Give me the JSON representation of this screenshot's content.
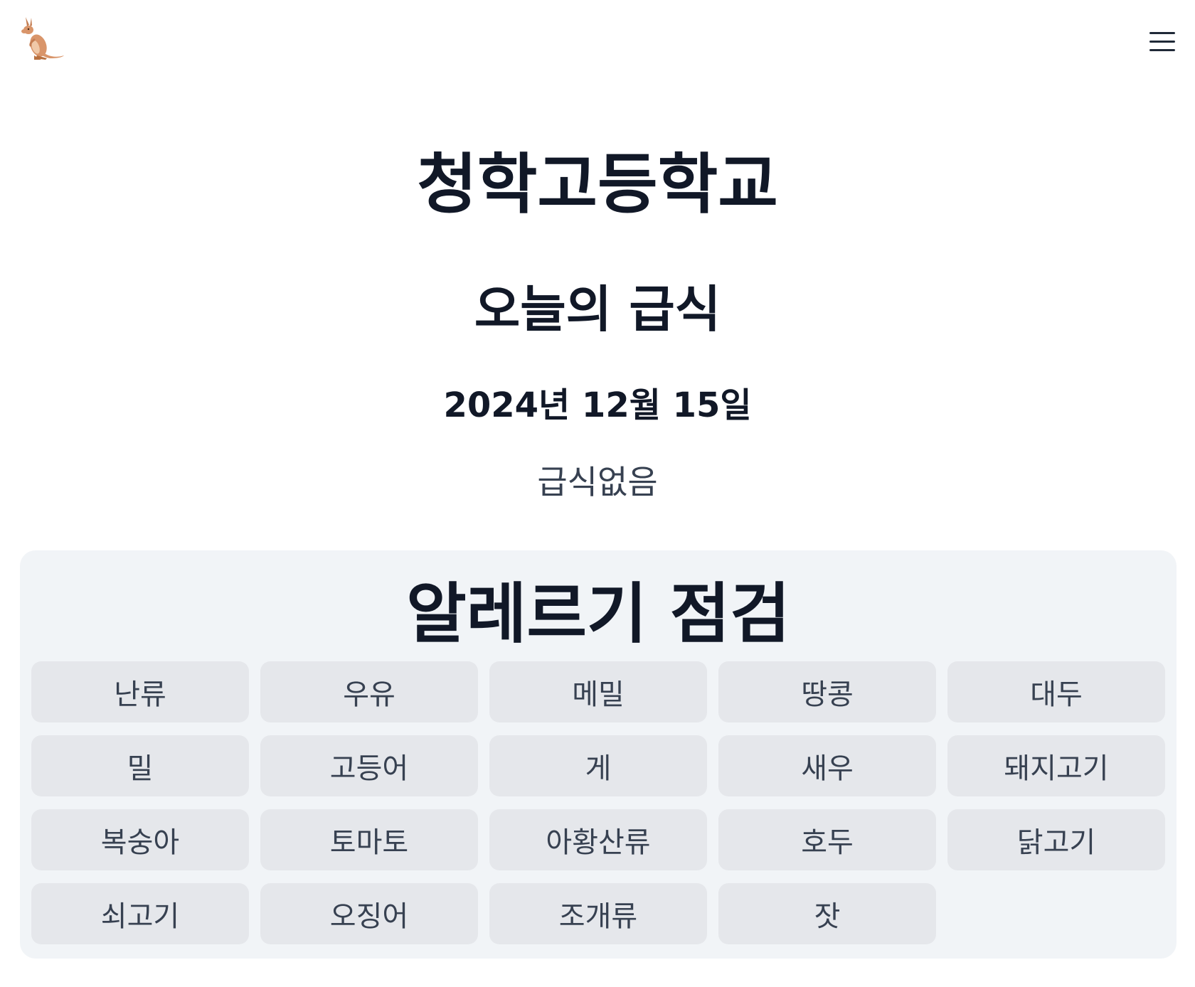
{
  "header": {
    "logo_icon": "kangaroo-icon",
    "menu_icon": "hamburger-menu-icon"
  },
  "school": {
    "name": "청학고등학교"
  },
  "meal": {
    "heading": "오늘의 급식",
    "date": "2024년 12월 15일",
    "status": "급식없음"
  },
  "allergy": {
    "title": "알레르기 점검",
    "items": [
      "난류",
      "우유",
      "메밀",
      "땅콩",
      "대두",
      "밀",
      "고등어",
      "게",
      "새우",
      "돼지고기",
      "복숭아",
      "토마토",
      "아황산류",
      "호두",
      "닭고기",
      "쇠고기",
      "오징어",
      "조개류",
      "잣"
    ]
  }
}
